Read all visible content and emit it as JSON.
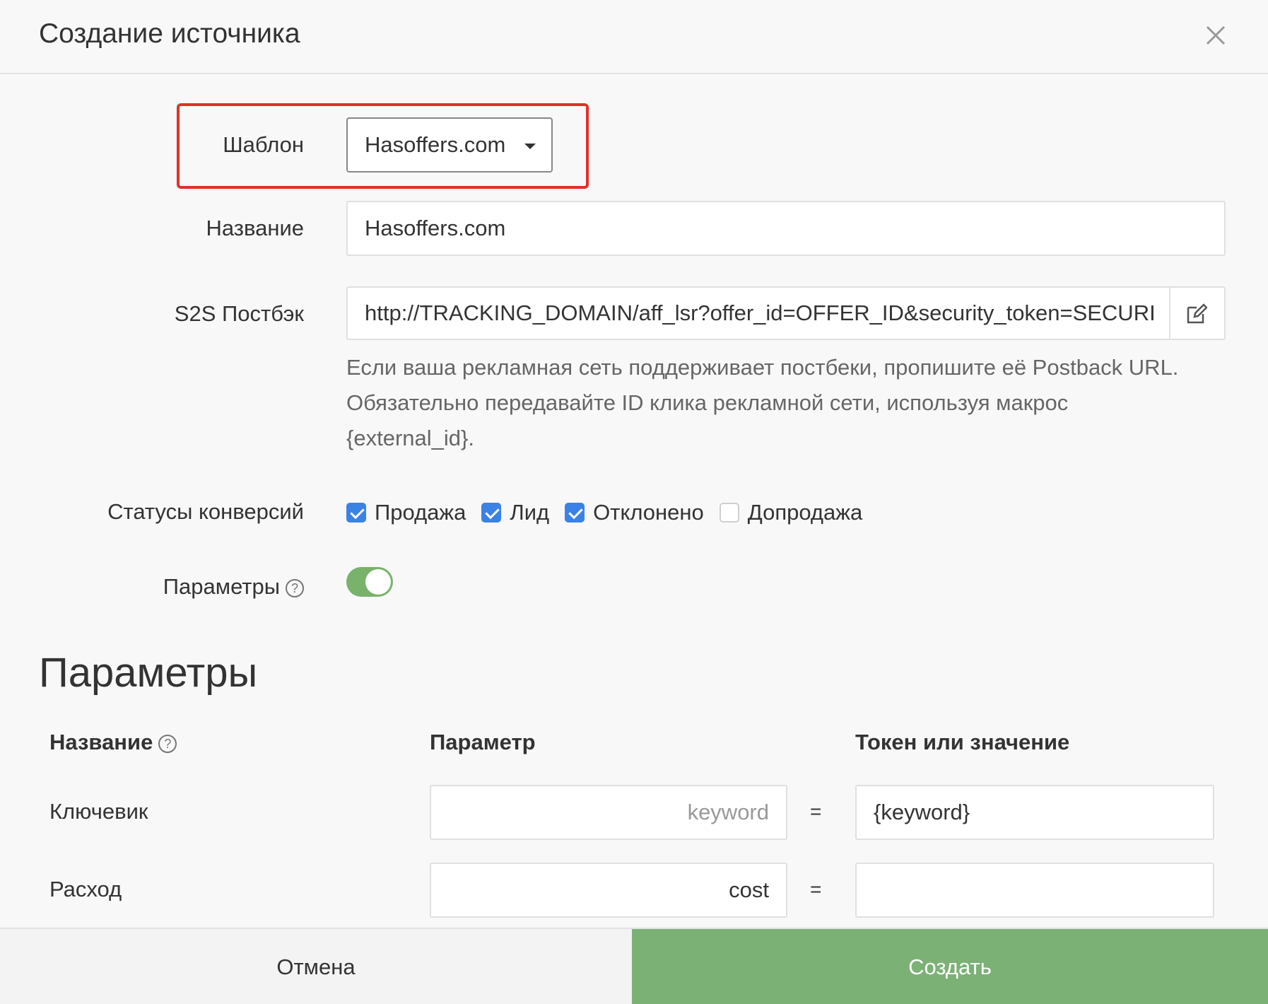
{
  "dialog": {
    "title": "Создание источника",
    "close_icon": "close-icon"
  },
  "form": {
    "template": {
      "label": "Шаблон",
      "value": "Hasoffers.com"
    },
    "name": {
      "label": "Название",
      "value": "Hasoffers.com"
    },
    "postback": {
      "label": "S2S Постбэк",
      "value": "http://TRACKING_DOMAIN/aff_lsr?offer_id=OFFER_ID&security_token=SECURI",
      "edit_icon": "edit-icon",
      "help": [
        "Если ваша рекламная сеть поддерживает постбеки, пропишите её Postback URL.",
        "Обязательно передавайте ID клика рекламной сети, используя макрос",
        "{external_id}."
      ]
    },
    "statuses": {
      "label": "Статусы конверсий",
      "items": [
        {
          "label": "Продажа",
          "checked": true
        },
        {
          "label": "Лид",
          "checked": true
        },
        {
          "label": "Отклонено",
          "checked": true
        },
        {
          "label": "Допродажа",
          "checked": false
        }
      ]
    },
    "params_toggle": {
      "label": "Параметры",
      "help_icon": "question-icon",
      "on": true
    }
  },
  "params": {
    "title": "Параметры",
    "headers": {
      "name": "Название",
      "param": "Параметр",
      "token": "Токен или значение"
    },
    "rows": [
      {
        "name": "Ключевик",
        "param_placeholder": "keyword",
        "equals": "=",
        "token": "{keyword}"
      },
      {
        "name": "Расход",
        "param_value": "cost",
        "equals": "=",
        "token": ""
      }
    ]
  },
  "footer": {
    "cancel": "Отмена",
    "create": "Создать"
  },
  "colors": {
    "accent_green": "#7cb176",
    "checkbox_blue": "#3b82e6",
    "highlight_red": "#e0302a"
  }
}
